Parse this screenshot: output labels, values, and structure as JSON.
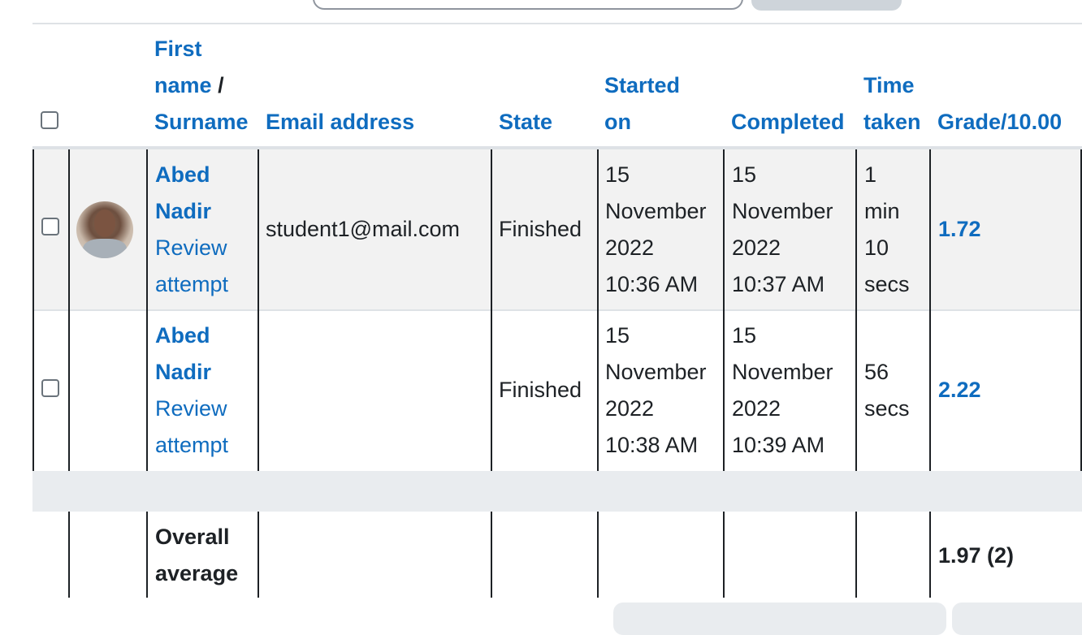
{
  "header": {
    "first_name": "First",
    "name_word": "name",
    "slash": "/",
    "surname": "Surname",
    "email": "Email address",
    "state": "State",
    "started_1": "Started",
    "started_2": "on",
    "completed": "Completed",
    "time_1": "Time",
    "time_2": "taken",
    "grade": "Grade/10.00"
  },
  "rows": [
    {
      "first": "Abed",
      "last": "Nadir",
      "review_1": "Review",
      "review_2": "attempt",
      "email": "student1@mail.com",
      "state": "Finished",
      "started": [
        "15",
        "November",
        "2022",
        "10:36 AM"
      ],
      "completed": [
        "15",
        "November",
        "2022",
        "10:37 AM"
      ],
      "time": [
        "1",
        "min",
        "10",
        "secs"
      ],
      "grade": "1.72"
    },
    {
      "first": "Abed",
      "last": "Nadir",
      "review_1": "Review",
      "review_2": "attempt",
      "email": "",
      "state": "Finished",
      "started": [
        "15",
        "November",
        "2022",
        "10:38 AM"
      ],
      "completed": [
        "15",
        "November",
        "2022",
        "10:39 AM"
      ],
      "time": [
        "56",
        "secs"
      ],
      "grade": "2.22"
    }
  ],
  "average": {
    "label_1": "Overall",
    "label_2": "average",
    "grade": "1.97 (2)"
  },
  "colors": {
    "link": "#0f6cbf",
    "row_alt": "#f2f2f2",
    "spacer": "#e9ecef"
  }
}
